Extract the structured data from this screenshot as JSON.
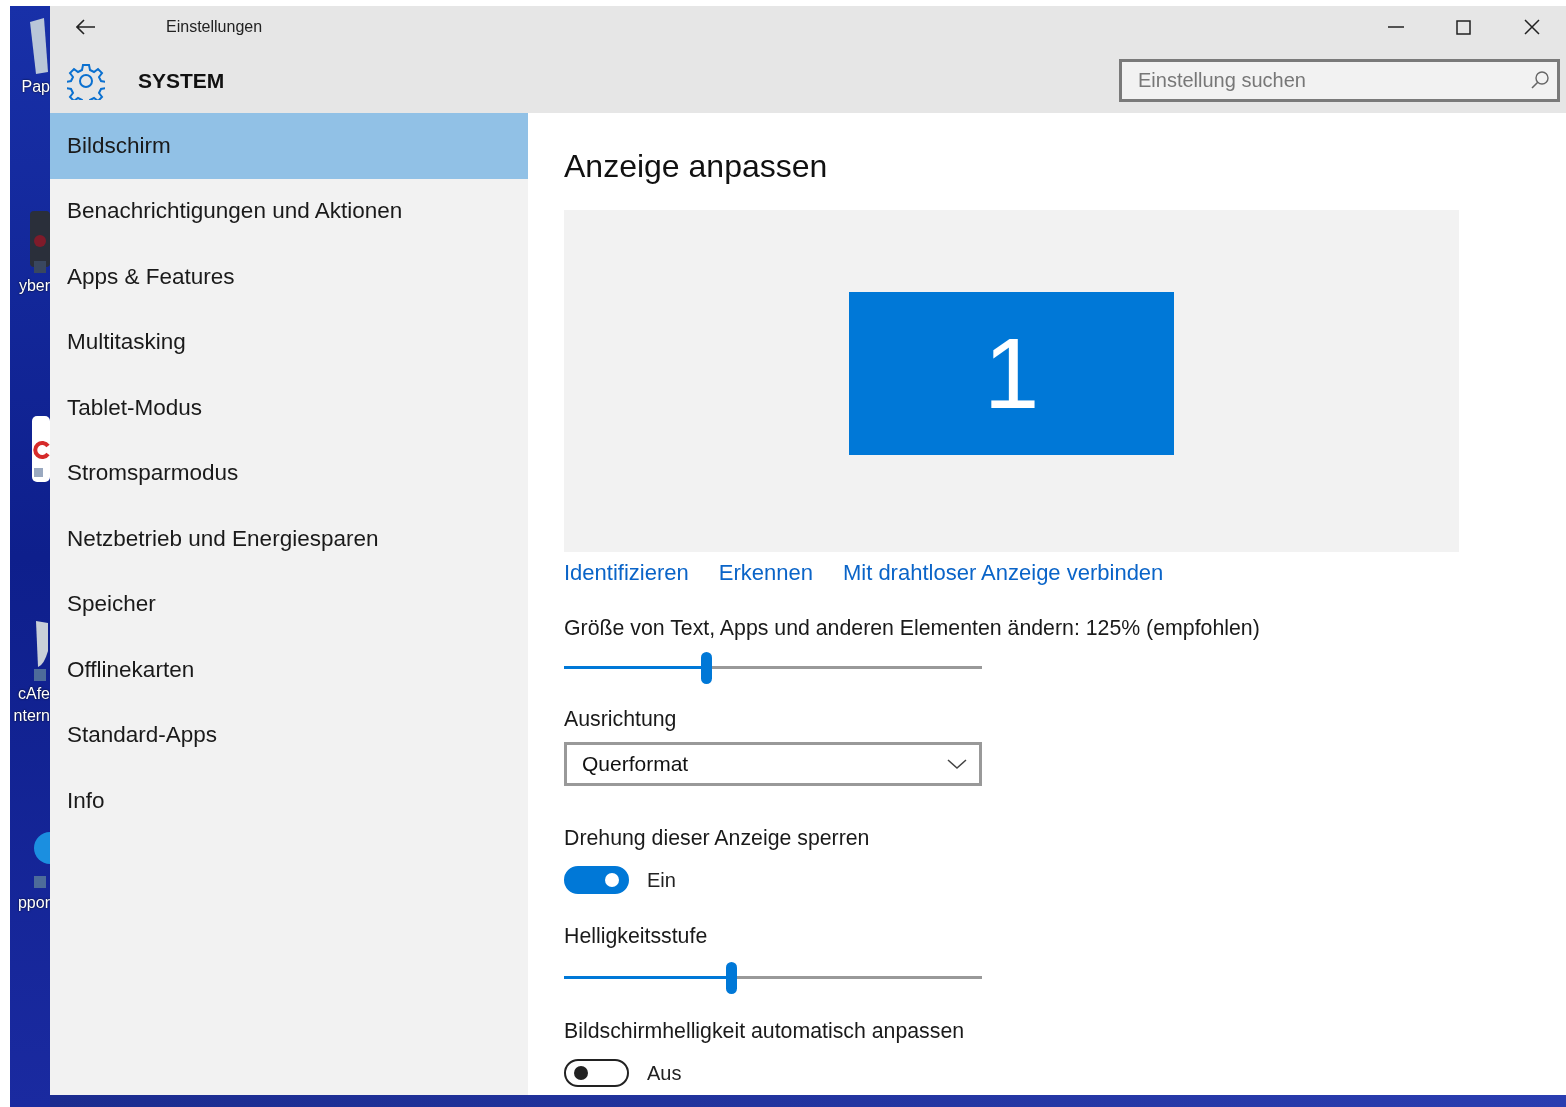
{
  "desktop_icons": [
    {
      "kind": "bin",
      "lines": [
        "Pap"
      ]
    },
    {
      "kind": "app",
      "lines": [
        "yber"
      ]
    },
    {
      "kind": "browser"
    },
    {
      "kind": "shield",
      "lines": [
        "cAfe",
        "ntern"
      ]
    },
    {
      "kind": "globe",
      "lines": [
        "ppor"
      ]
    }
  ],
  "window": {
    "title": "Einstellungen",
    "section": "SYSTEM",
    "search": {
      "placeholder": "Einstellung suchen"
    }
  },
  "sidebar": {
    "items": [
      {
        "label": "Bildschirm",
        "selected": true
      },
      {
        "label": "Benachrichtigungen und Aktionen",
        "selected": false
      },
      {
        "label": "Apps & Features",
        "selected": false
      },
      {
        "label": "Multitasking",
        "selected": false
      },
      {
        "label": "Tablet-Modus",
        "selected": false
      },
      {
        "label": "Stromsparmodus",
        "selected": false
      },
      {
        "label": "Netzbetrieb und Energiesparen",
        "selected": false
      },
      {
        "label": "Speicher",
        "selected": false
      },
      {
        "label": "Offlinekarten",
        "selected": false
      },
      {
        "label": "Standard-Apps",
        "selected": false
      },
      {
        "label": "Info",
        "selected": false
      }
    ]
  },
  "content": {
    "heading": "Anzeige anpassen",
    "monitor": "1",
    "links": [
      "Identifizieren",
      "Erkennen",
      "Mit drahtloser Anzeige verbinden"
    ],
    "scale": {
      "label": "Größe von Text, Apps und anderen Elementen ändern: 125% (empfohlen)",
      "level": 0.34
    },
    "orientation": {
      "label": "Ausrichtung",
      "value": "Querformat"
    },
    "rotation_lock": {
      "label": "Drehung dieser Anzeige sperren",
      "on": true,
      "state": "Ein"
    },
    "brightness": {
      "label": "Helligkeitsstufe",
      "level": 0.4
    },
    "auto_brightness": {
      "label": "Bildschirmhelligkeit automatisch anpassen",
      "on": false,
      "state": "Aus"
    }
  }
}
